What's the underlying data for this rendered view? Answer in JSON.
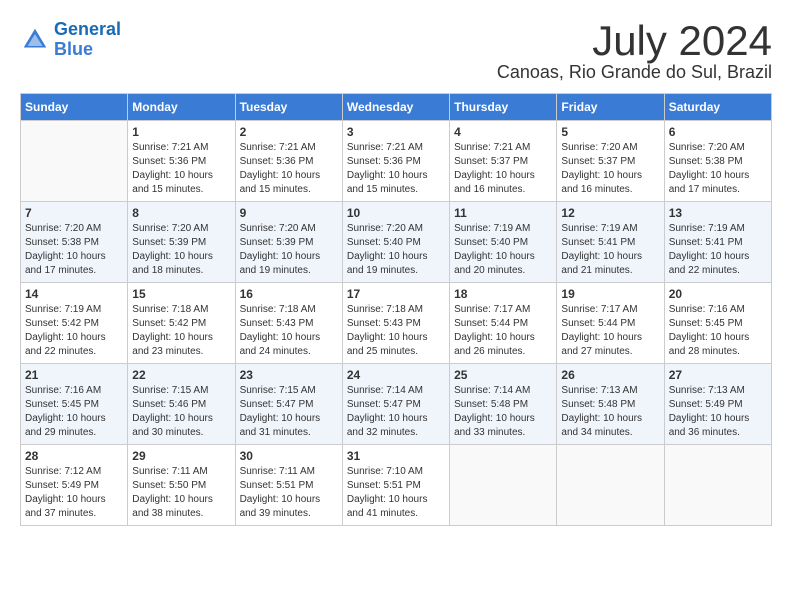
{
  "header": {
    "logo_line1": "General",
    "logo_line2": "Blue",
    "month_year": "July 2024",
    "location": "Canoas, Rio Grande do Sul, Brazil"
  },
  "weekdays": [
    "Sunday",
    "Monday",
    "Tuesday",
    "Wednesday",
    "Thursday",
    "Friday",
    "Saturday"
  ],
  "weeks": [
    [
      {
        "day": "",
        "sunrise": "",
        "sunset": "",
        "daylight": ""
      },
      {
        "day": "1",
        "sunrise": "Sunrise: 7:21 AM",
        "sunset": "Sunset: 5:36 PM",
        "daylight": "Daylight: 10 hours and 15 minutes."
      },
      {
        "day": "2",
        "sunrise": "Sunrise: 7:21 AM",
        "sunset": "Sunset: 5:36 PM",
        "daylight": "Daylight: 10 hours and 15 minutes."
      },
      {
        "day": "3",
        "sunrise": "Sunrise: 7:21 AM",
        "sunset": "Sunset: 5:36 PM",
        "daylight": "Daylight: 10 hours and 15 minutes."
      },
      {
        "day": "4",
        "sunrise": "Sunrise: 7:21 AM",
        "sunset": "Sunset: 5:37 PM",
        "daylight": "Daylight: 10 hours and 16 minutes."
      },
      {
        "day": "5",
        "sunrise": "Sunrise: 7:20 AM",
        "sunset": "Sunset: 5:37 PM",
        "daylight": "Daylight: 10 hours and 16 minutes."
      },
      {
        "day": "6",
        "sunrise": "Sunrise: 7:20 AM",
        "sunset": "Sunset: 5:38 PM",
        "daylight": "Daylight: 10 hours and 17 minutes."
      }
    ],
    [
      {
        "day": "7",
        "sunrise": "Sunrise: 7:20 AM",
        "sunset": "Sunset: 5:38 PM",
        "daylight": "Daylight: 10 hours and 17 minutes."
      },
      {
        "day": "8",
        "sunrise": "Sunrise: 7:20 AM",
        "sunset": "Sunset: 5:39 PM",
        "daylight": "Daylight: 10 hours and 18 minutes."
      },
      {
        "day": "9",
        "sunrise": "Sunrise: 7:20 AM",
        "sunset": "Sunset: 5:39 PM",
        "daylight": "Daylight: 10 hours and 19 minutes."
      },
      {
        "day": "10",
        "sunrise": "Sunrise: 7:20 AM",
        "sunset": "Sunset: 5:40 PM",
        "daylight": "Daylight: 10 hours and 19 minutes."
      },
      {
        "day": "11",
        "sunrise": "Sunrise: 7:19 AM",
        "sunset": "Sunset: 5:40 PM",
        "daylight": "Daylight: 10 hours and 20 minutes."
      },
      {
        "day": "12",
        "sunrise": "Sunrise: 7:19 AM",
        "sunset": "Sunset: 5:41 PM",
        "daylight": "Daylight: 10 hours and 21 minutes."
      },
      {
        "day": "13",
        "sunrise": "Sunrise: 7:19 AM",
        "sunset": "Sunset: 5:41 PM",
        "daylight": "Daylight: 10 hours and 22 minutes."
      }
    ],
    [
      {
        "day": "14",
        "sunrise": "Sunrise: 7:19 AM",
        "sunset": "Sunset: 5:42 PM",
        "daylight": "Daylight: 10 hours and 22 minutes."
      },
      {
        "day": "15",
        "sunrise": "Sunrise: 7:18 AM",
        "sunset": "Sunset: 5:42 PM",
        "daylight": "Daylight: 10 hours and 23 minutes."
      },
      {
        "day": "16",
        "sunrise": "Sunrise: 7:18 AM",
        "sunset": "Sunset: 5:43 PM",
        "daylight": "Daylight: 10 hours and 24 minutes."
      },
      {
        "day": "17",
        "sunrise": "Sunrise: 7:18 AM",
        "sunset": "Sunset: 5:43 PM",
        "daylight": "Daylight: 10 hours and 25 minutes."
      },
      {
        "day": "18",
        "sunrise": "Sunrise: 7:17 AM",
        "sunset": "Sunset: 5:44 PM",
        "daylight": "Daylight: 10 hours and 26 minutes."
      },
      {
        "day": "19",
        "sunrise": "Sunrise: 7:17 AM",
        "sunset": "Sunset: 5:44 PM",
        "daylight": "Daylight: 10 hours and 27 minutes."
      },
      {
        "day": "20",
        "sunrise": "Sunrise: 7:16 AM",
        "sunset": "Sunset: 5:45 PM",
        "daylight": "Daylight: 10 hours and 28 minutes."
      }
    ],
    [
      {
        "day": "21",
        "sunrise": "Sunrise: 7:16 AM",
        "sunset": "Sunset: 5:45 PM",
        "daylight": "Daylight: 10 hours and 29 minutes."
      },
      {
        "day": "22",
        "sunrise": "Sunrise: 7:15 AM",
        "sunset": "Sunset: 5:46 PM",
        "daylight": "Daylight: 10 hours and 30 minutes."
      },
      {
        "day": "23",
        "sunrise": "Sunrise: 7:15 AM",
        "sunset": "Sunset: 5:47 PM",
        "daylight": "Daylight: 10 hours and 31 minutes."
      },
      {
        "day": "24",
        "sunrise": "Sunrise: 7:14 AM",
        "sunset": "Sunset: 5:47 PM",
        "daylight": "Daylight: 10 hours and 32 minutes."
      },
      {
        "day": "25",
        "sunrise": "Sunrise: 7:14 AM",
        "sunset": "Sunset: 5:48 PM",
        "daylight": "Daylight: 10 hours and 33 minutes."
      },
      {
        "day": "26",
        "sunrise": "Sunrise: 7:13 AM",
        "sunset": "Sunset: 5:48 PM",
        "daylight": "Daylight: 10 hours and 34 minutes."
      },
      {
        "day": "27",
        "sunrise": "Sunrise: 7:13 AM",
        "sunset": "Sunset: 5:49 PM",
        "daylight": "Daylight: 10 hours and 36 minutes."
      }
    ],
    [
      {
        "day": "28",
        "sunrise": "Sunrise: 7:12 AM",
        "sunset": "Sunset: 5:49 PM",
        "daylight": "Daylight: 10 hours and 37 minutes."
      },
      {
        "day": "29",
        "sunrise": "Sunrise: 7:11 AM",
        "sunset": "Sunset: 5:50 PM",
        "daylight": "Daylight: 10 hours and 38 minutes."
      },
      {
        "day": "30",
        "sunrise": "Sunrise: 7:11 AM",
        "sunset": "Sunset: 5:51 PM",
        "daylight": "Daylight: 10 hours and 39 minutes."
      },
      {
        "day": "31",
        "sunrise": "Sunrise: 7:10 AM",
        "sunset": "Sunset: 5:51 PM",
        "daylight": "Daylight: 10 hours and 41 minutes."
      },
      {
        "day": "",
        "sunrise": "",
        "sunset": "",
        "daylight": ""
      },
      {
        "day": "",
        "sunrise": "",
        "sunset": "",
        "daylight": ""
      },
      {
        "day": "",
        "sunrise": "",
        "sunset": "",
        "daylight": ""
      }
    ]
  ]
}
